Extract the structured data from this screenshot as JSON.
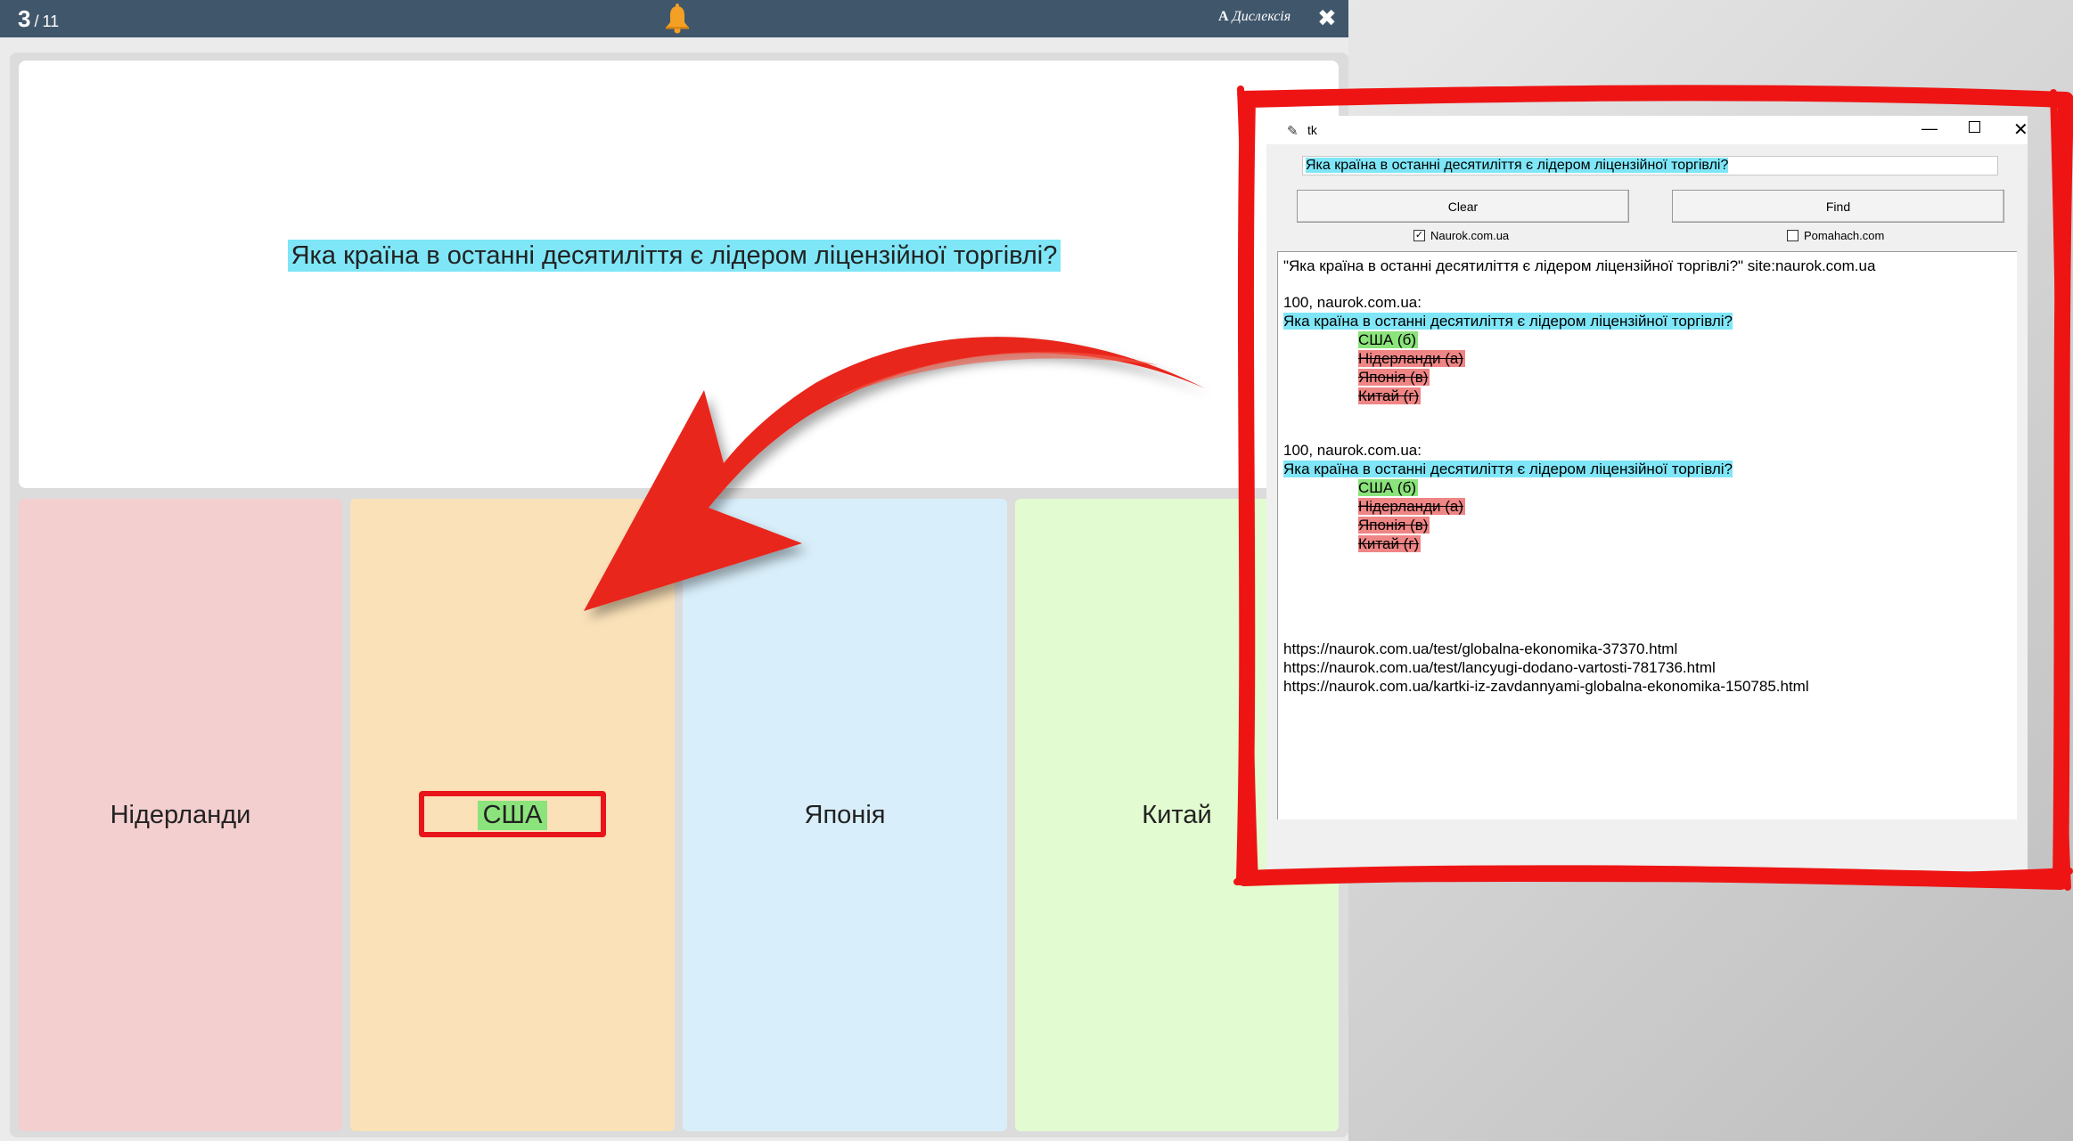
{
  "quiz": {
    "counter_current": "3",
    "counter_sep": "/",
    "counter_total": "11",
    "dyslexia_icon": "A",
    "dyslexia_label": "Дислексія",
    "close_icon": "✖",
    "question": "Яка країна в останні десятиліття є лідером ліцензійної торгівлі?",
    "options": [
      "Нідерланди",
      "США",
      "Японія",
      "Китай"
    ],
    "highlighted_option": "США",
    "colors": {
      "topbar": "#40566b",
      "option1": "#f4cfd0",
      "option2": "#fae1b8",
      "option3": "#d8eefa",
      "option4": "#e2fbd0",
      "question_highlight": "#7ee6f7",
      "answer_highlight": "#8be37b",
      "annotation_red": "#e8151b"
    }
  },
  "tk": {
    "title": "tk",
    "search_value": "Яка країна в останні десятиліття є лідером ліцензійної торгівлі?",
    "clear_label": "Clear",
    "find_label": "Find",
    "check1_label": "Naurok.com.ua",
    "check1_checked": "✓",
    "check2_label": "Pomahach.com",
    "output": {
      "query": "\"Яка країна в останні десятиліття є лідером ліцензійної торгівлі?\" site:naurok.com.ua",
      "results": [
        {
          "source": "100, naurok.com.ua:",
          "question": "Яка країна в останні десятиліття є лідером ліцензійної торгівлі?",
          "correct": "США (б)",
          "wrong": [
            "Нідерланди (а)",
            "Японія (в)",
            "Китай (г)"
          ]
        },
        {
          "source": "100, naurok.com.ua:",
          "question": "Яка країна в останні десятиліття є лідером ліцензійної торгівлі?",
          "correct": "США (б)",
          "wrong": [
            "Нідерланди (а)",
            "Японія (в)",
            "Китай (г)"
          ]
        }
      ],
      "links": [
        "https://naurok.com.ua/test/globalna-ekonomika-37370.html",
        "https://naurok.com.ua/test/lancyugi-dodano-vartosti-781736.html",
        "https://naurok.com.ua/kartki-iz-zavdannyami-globalna-ekonomika-150785.html"
      ]
    }
  }
}
